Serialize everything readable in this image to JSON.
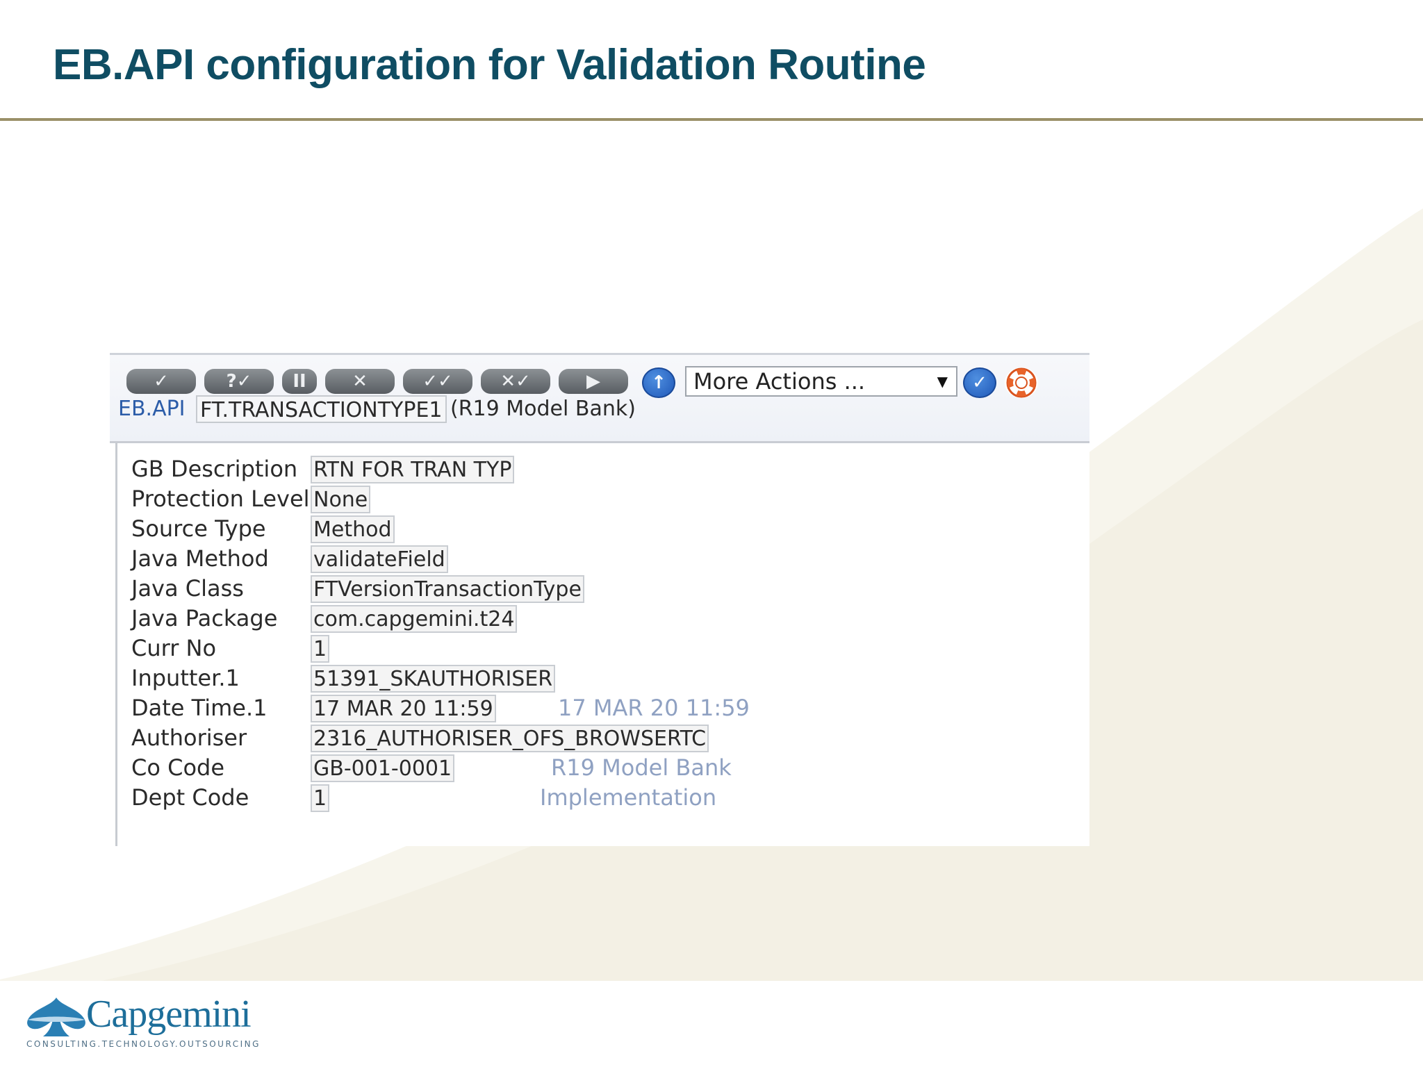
{
  "slide": {
    "title": "EB.API configuration for Validation Routine"
  },
  "logo": {
    "name": "Capgemini",
    "tagline": "CONSULTING.TECHNOLOGY.OUTSOURCING"
  },
  "toolbar": {
    "buttons": [
      {
        "icon": "commit-check-icon",
        "glyph": "✓"
      },
      {
        "icon": "validate-icon",
        "glyph": "?✓"
      },
      {
        "icon": "hold-icon",
        "glyph": "II"
      },
      {
        "icon": "delete-icon",
        "glyph": "✕"
      },
      {
        "icon": "authorise-icon",
        "glyph": "✓✓"
      },
      {
        "icon": "reverse-icon",
        "glyph": "✕✓"
      },
      {
        "icon": "next-icon",
        "glyph": "▶"
      }
    ],
    "more_actions": "More Actions ...",
    "select_arrow": "▼"
  },
  "header": {
    "application": "EB.API",
    "record_id": "FT.TRANSACTIONTYPE1",
    "company": "(R19 Model Bank)"
  },
  "fields": [
    {
      "label": "GB Description",
      "value": "RTN FOR TRAN TYP"
    },
    {
      "label": "Protection Level",
      "value": "None"
    },
    {
      "label": "Source Type",
      "value": "Method"
    },
    {
      "label": "Java Method",
      "value": "validateField"
    },
    {
      "label": "Java Class",
      "value": "FTVersionTransactionType"
    },
    {
      "label": "Java Package",
      "value": "com.capgemini.t24"
    },
    {
      "label": "Curr No",
      "value": "1"
    },
    {
      "label": "Inputter.1",
      "value": "51391_SKAUTHORISER"
    },
    {
      "label": "Date Time.1",
      "value": "17 MAR 20 11:59",
      "enrichment": "17 MAR 20 11:59"
    },
    {
      "label": "Authoriser",
      "value": "2316_AUTHORISER_OFS_BROWSERTC"
    },
    {
      "label": "Co Code",
      "value": "GB-001-0001",
      "enrichment": "R19 Model Bank"
    },
    {
      "label": "Dept Code",
      "value": "1",
      "enrichment": "Implementation"
    }
  ],
  "colors": {
    "title": "#0f4d63",
    "rule": "#9a9068",
    "enrichment": "#8fa1c2",
    "app_name": "#2b5ca8"
  }
}
